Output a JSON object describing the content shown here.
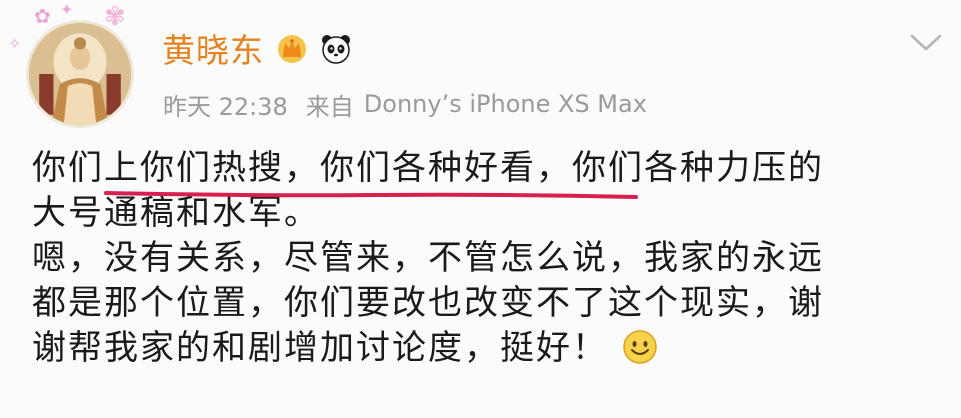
{
  "post": {
    "author": {
      "name": "黄晓东",
      "badges": [
        "crown-icon",
        "panda-icon"
      ]
    },
    "meta": {
      "time": "昨天 22:38",
      "source_prefix": "来自",
      "device": "Donny’s iPhone XS Max"
    },
    "text_lines": [
      "你们上你们热搜，你们各种好看，你们各种力压的",
      "大号通稿和水军。",
      "嗯，没有关系，尽管来，不管怎么说，我家的永远",
      "都是那个位置，你们要改也改变不了这个现实，谢",
      "谢帮我家的和剧增加讨论度，挺好！"
    ],
    "underline_color": "#d8204f",
    "emoji": "smile-emoji-icon"
  },
  "colors": {
    "username": "#e6821e",
    "meta": "#9a9a9a",
    "text": "#1a1a1a"
  }
}
